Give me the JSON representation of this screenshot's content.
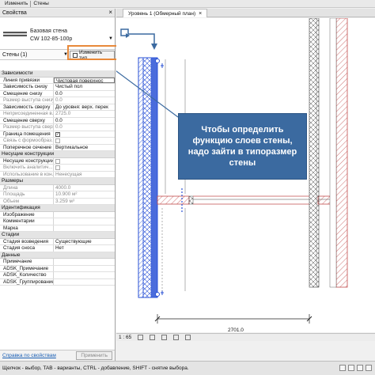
{
  "ribbon": {
    "item1": "Изменить",
    "item2": "Стены"
  },
  "properties": {
    "title": "Свойства",
    "close": "×",
    "type_family": "Базовая стена",
    "type_name": "CW 102-85-100p",
    "instance_label": "Стены (1)",
    "edit_type_button": "Изменить тип",
    "groups": [
      {
        "label": "Зависимости",
        "rows": [
          {
            "key": "Линия привязки",
            "value": "Чистовая поверхнос",
            "box": true
          },
          {
            "key": "Зависимость снизу",
            "value": "Чистый пол"
          },
          {
            "key": "Смещение снизу",
            "value": "0.0"
          },
          {
            "key": "Размер выступа снизу",
            "value": "0.0",
            "disabled": true
          },
          {
            "key": "Зависимость сверху",
            "value": "До уровня: верх. перек"
          },
          {
            "key": "Неприсоединенная в...",
            "value": "2725.0",
            "disabled": true
          },
          {
            "key": "Смещение сверху",
            "value": "0.0"
          },
          {
            "key": "Размер выступа сверху",
            "value": "0.0",
            "disabled": true
          },
          {
            "key": "Граница помещения",
            "value": "",
            "check": true
          },
          {
            "key": "Связь с формообраз...",
            "value": "",
            "check": false,
            "disabled": true
          },
          {
            "key": "Поперечное сечение",
            "value": "Вертикальное"
          }
        ]
      },
      {
        "label": "Несущие конструкции",
        "rows": [
          {
            "key": "Несущие конструкции",
            "value": "",
            "check": false
          },
          {
            "key": "Включить аналитич...",
            "value": "",
            "check": false,
            "disabled": true
          },
          {
            "key": "Использование в кон...",
            "value": "Ненесущая",
            "disabled": true
          }
        ]
      },
      {
        "label": "Размеры",
        "rows": [
          {
            "key": "Длина",
            "value": "4000.0",
            "disabled": true
          },
          {
            "key": "Площадь",
            "value": "10.900 м²",
            "disabled": true
          },
          {
            "key": "Объем",
            "value": "3.259 м³",
            "disabled": true
          }
        ]
      },
      {
        "label": "Идентификация",
        "rows": [
          {
            "key": "Изображение",
            "value": ""
          },
          {
            "key": "Комментарии",
            "value": ""
          },
          {
            "key": "Марка",
            "value": ""
          }
        ]
      },
      {
        "label": "Стадии",
        "rows": [
          {
            "key": "Стадия возведения",
            "value": "Существующие"
          },
          {
            "key": "Стадия сноса",
            "value": "Нет"
          }
        ]
      },
      {
        "label": "Данные",
        "rows": [
          {
            "key": "Примечание",
            "value": ""
          },
          {
            "key": "ADSK_Примечание",
            "value": ""
          },
          {
            "key": "ADSK_Количество",
            "value": ""
          },
          {
            "key": "ADSK_Группирование",
            "value": ""
          }
        ]
      }
    ],
    "help_link": "Справка по свойствам",
    "apply_button": "Применить"
  },
  "view": {
    "tab_label": "Уровень 1 (Обмерный план)",
    "tab_close": "×",
    "callout_text": "Чтобы определить функцию слоев стены, надо зайти в типоразмер стены",
    "dimension_label": "2701.0",
    "scale": "1 : 65"
  },
  "status_bar": {
    "text": "Щелчок - выбор, TAB - варианты, CTRL - добавление, SHIFT - снятие выбора."
  },
  "colors": {
    "callout_bg": "#3b6aa0",
    "highlight": "#e8893a",
    "selected_wall": "#2a52d6",
    "hatch_red": "#c24b4b"
  }
}
